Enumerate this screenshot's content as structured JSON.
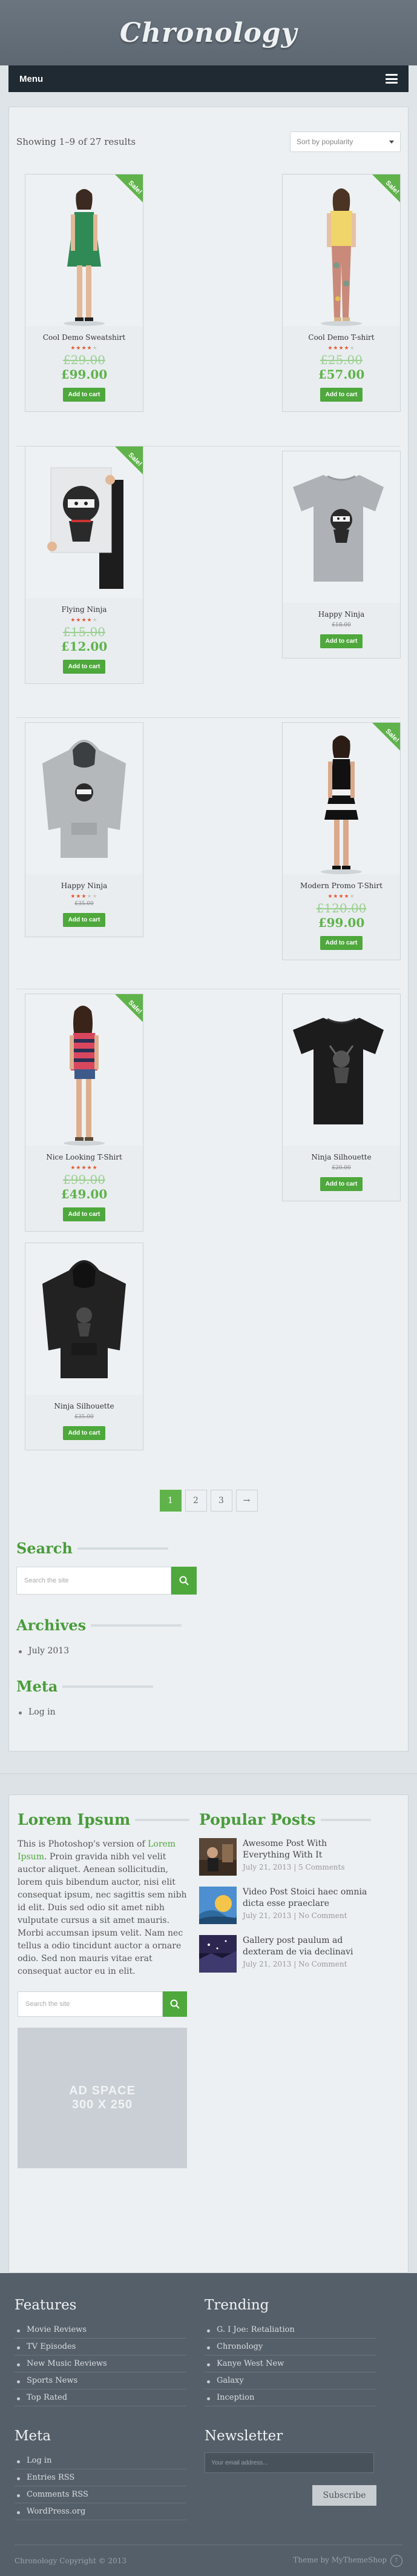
{
  "site": {
    "title": "Chronology"
  },
  "menu": {
    "label": "Menu"
  },
  "shop": {
    "result_count": "Showing 1–9 of 27 results",
    "orderby": "Sort by popularity"
  },
  "products": [
    {
      "title": "Cool Demo Sweatshirt",
      "sale": "Sale!",
      "rating": 4,
      "old_price": "£29.00",
      "price": "£99.00",
      "button": "Add to cart",
      "accent": "#2f8a55"
    },
    {
      "title": "Cool Demo T-shirt",
      "sale": "Sale!",
      "rating": 4,
      "old_price": "£25.00",
      "price": "£57.00",
      "button": "Add to cart",
      "accent": "#f0d56a"
    },
    {
      "title": "Flying Ninja",
      "sale": "Sale!",
      "rating": 4,
      "old_price": "£15.00",
      "price": "£12.00",
      "button": "Add to cart",
      "accent": "#d5d8db"
    },
    {
      "title": "Happy Ninja",
      "rating": 0,
      "price": "£18.00",
      "button": "Add to cart",
      "accent": "#aeb2b6"
    },
    {
      "title": "Happy Ninja",
      "rating": 3,
      "price": "£35.00",
      "button": "Add to cart",
      "accent": "#b5b8bb"
    },
    {
      "title": "Modern Promo T-Shirt",
      "sale": "Sale!",
      "rating": 4,
      "old_price": "£120.00",
      "price": "£99.00",
      "button": "Add to cart",
      "accent": "#111111"
    },
    {
      "title": "Nice Looking T-Shirt",
      "sale": "Sale!",
      "rating": 5,
      "old_price": "£99.00",
      "price": "£49.00",
      "button": "Add to cart",
      "accent": "#d9475f"
    },
    {
      "title": "Ninja Silhouette",
      "rating": 0,
      "price": "£20.00",
      "button": "Add to cart",
      "accent": "#1c1c1c"
    },
    {
      "title": "Ninja Silhouette",
      "rating": 0,
      "price": "£35.00",
      "button": "Add to cart",
      "accent": "#222222"
    }
  ],
  "pagination": {
    "pages": [
      "1",
      "2",
      "3",
      "→"
    ]
  },
  "sidebar": {
    "search_title": "Search",
    "search_placeholder": "Search the site",
    "archives_title": "Archives",
    "archives": [
      "July 2013"
    ],
    "meta_title": "Meta",
    "meta": [
      "Log in"
    ]
  },
  "bottom": {
    "lorem_title": "Lorem Ipsum",
    "lorem_lead": "This is Photoshop's version of ",
    "lorem_link": "Lorem Ipsum",
    "lorem_text": ". Proin gravida nibh vel velit auctor aliquet. Aenean sollicitudin, lorem quis bibendum auctor, nisi elit consequat ipsum, nec sagittis sem nibh id elit. Duis sed odio sit amet nibh vulputate cursus a sit amet mauris. Morbi accumsan ipsum velit. Nam nec tellus a odio tincidunt auctor a ornare odio. Sed non mauris vitae erat consequat auctor eu in elit.",
    "search_placeholder": "Search the site",
    "ad_line1": "AD SPACE",
    "ad_line2": "300 X 250",
    "popular_title": "Popular Posts",
    "posts": [
      {
        "title": "Awesome Post With Everything With It",
        "date": "July 21, 2013",
        "comments": "5 Comments"
      },
      {
        "title": "Video Post Stoici haec omnia dicta esse praeclare",
        "date": "July 21, 2013",
        "comments": "No Comment"
      },
      {
        "title": "Gallery post paulum ad dexteram de via declinavi",
        "date": "July 21, 2013",
        "comments": "No Comment"
      }
    ]
  },
  "footer": {
    "features_title": "Features",
    "features": [
      "Movie Reviews",
      "TV Episodes",
      "New Music Reviews",
      "Sports News",
      "Top Rated"
    ],
    "trending_title": "Trending",
    "trending": [
      "G. I Joe: Retaliation",
      "Chronology",
      "Kanye West New",
      "Galaxy",
      "Inception"
    ],
    "meta_title": "Meta",
    "meta": [
      "Log in",
      "Entries RSS",
      "Comments RSS",
      "WordPress.org"
    ],
    "newsletter_title": "Newsletter",
    "newsletter_placeholder": "Your email address...",
    "subscribe": "Subscribe",
    "copyright": "Chronology Copyright © 2013",
    "credit": "Theme by MyThemeShop",
    "to_top": "↑"
  }
}
